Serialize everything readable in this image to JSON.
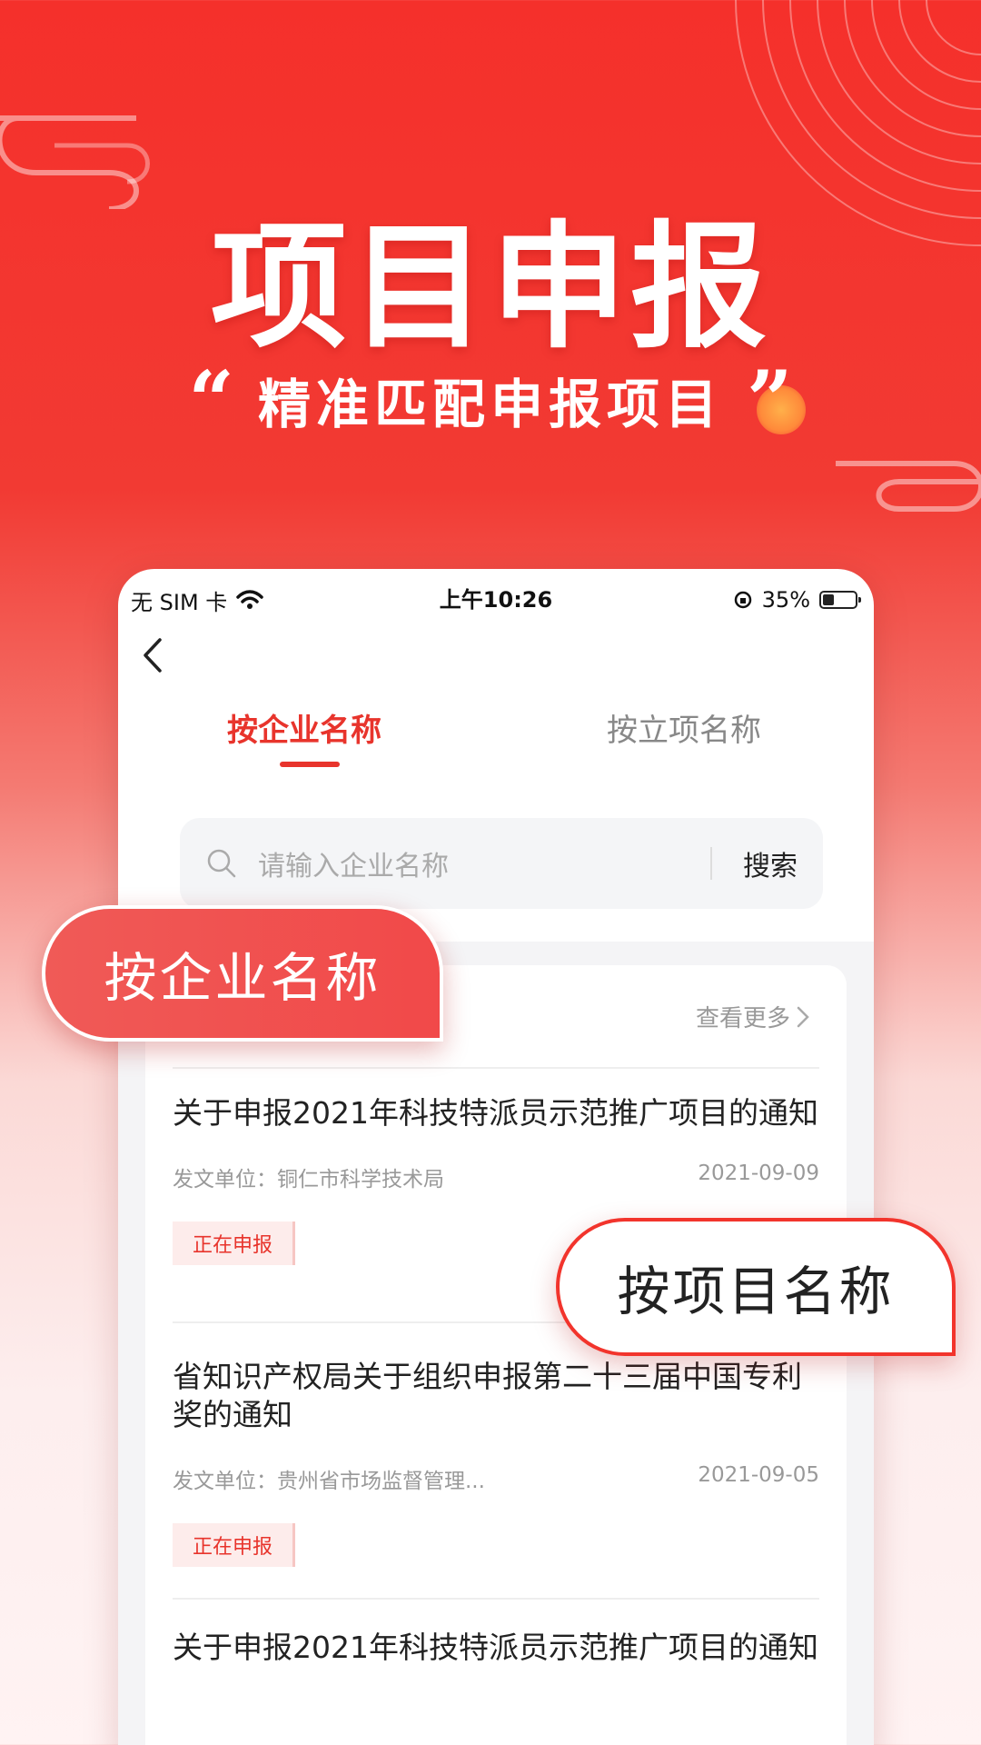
{
  "hero": {
    "title": "项目申报",
    "open_quote": "“",
    "subtitle": "精准匹配申报项目",
    "close_quote": "”"
  },
  "status_bar": {
    "carrier": "无 SIM 卡",
    "time": "上午10:26",
    "battery": "35%"
  },
  "tabs": [
    {
      "label": "按企业名称",
      "active": true
    },
    {
      "label": "按立项名称",
      "active": false
    }
  ],
  "search": {
    "placeholder": "请输入企业名称",
    "button": "搜索"
  },
  "list": {
    "more": "查看更多",
    "items": [
      {
        "title": "关于申报2021年科技特派员示范推广项目的通知",
        "issuer": "发文单位：铜仁市科学技术局",
        "date": "2021-09-09",
        "status": "正在申报"
      },
      {
        "title": "省知识产权局关于组织申报第二十三届中国专利奖的通知",
        "issuer": "发文单位：贵州省市场监督管理...",
        "date": "2021-09-05",
        "status": "正在申报"
      },
      {
        "title": "关于申报2021年科技特派员示范推广项目的通知"
      }
    ]
  },
  "callouts": {
    "left": "按企业名称",
    "right": "按项目名称"
  },
  "colors": {
    "brand_red": "#e8342c",
    "badge_bg": "#fdeceb"
  }
}
